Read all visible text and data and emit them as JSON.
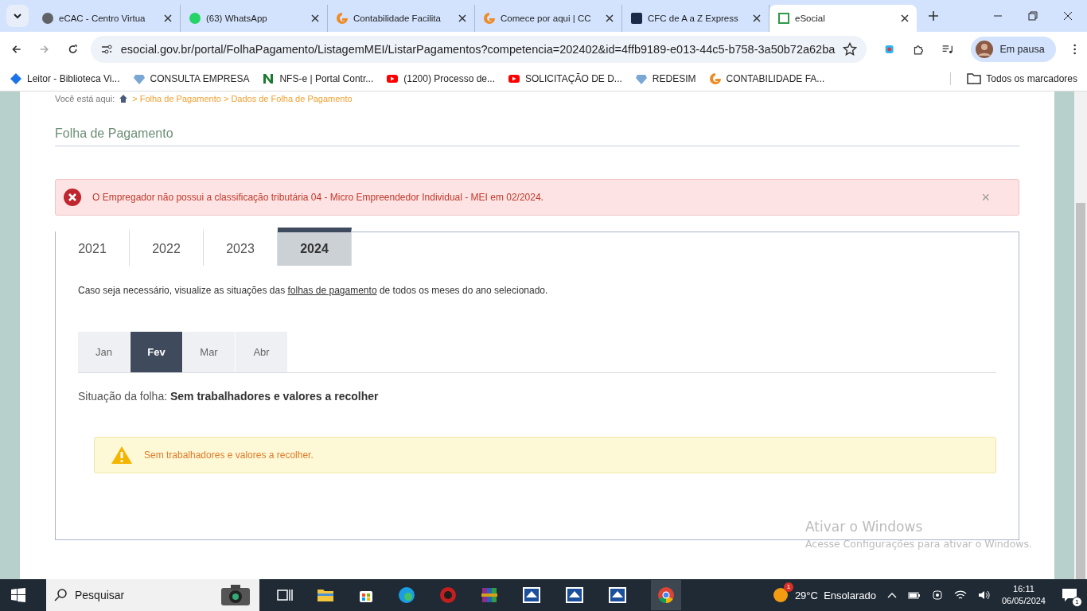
{
  "browser": {
    "tabs": [
      {
        "title": "eCAC - Centro Virtua",
        "selected": false
      },
      {
        "title": "(63) WhatsApp",
        "selected": false
      },
      {
        "title": "Contabilidade Facilita",
        "selected": false
      },
      {
        "title": "Comece por aqui | CC",
        "selected": false
      },
      {
        "title": "CFC de A a Z Express",
        "selected": false
      },
      {
        "title": "eSocial",
        "selected": true
      }
    ],
    "url": "esocial.gov.br/portal/FolhaPagamento/ListagemMEI/ListarPagamentos?competencia=202402&id=4ffb9189-e013-44c5-b758-3a50b72a62ba",
    "profile": "Em pausa",
    "bookmarks": [
      {
        "title": "Leitor - Biblioteca Vi..."
      },
      {
        "title": "CONSULTA EMPRESA"
      },
      {
        "title": "NFS-e | Portal Contr..."
      },
      {
        "title": "(1200) Processo de..."
      },
      {
        "title": "SOLICITAÇÃO DE D..."
      },
      {
        "title": "REDESIM"
      },
      {
        "title": "CONTABILIDADE FA..."
      }
    ],
    "all_bookmarks": "Todos os marcadores"
  },
  "breadcrumb": {
    "label": "Você está aqui:",
    "path": "> Folha de Pagamento > Dados de Folha de Pagamento"
  },
  "page_title": "Folha de Pagamento",
  "error_alert": {
    "message": "O Empregador não possui a classificação tributária 04 - Micro Empreendedor Individual - MEI em 02/2024.",
    "close": "×"
  },
  "years": [
    {
      "label": "2021",
      "selected": false
    },
    {
      "label": "2022",
      "selected": false
    },
    {
      "label": "2023",
      "selected": false
    },
    {
      "label": "2024",
      "selected": true
    }
  ],
  "intro": {
    "before": "Caso seja necessário, visualize as situações das ",
    "link": "folhas de pagamento",
    "after": " de todos os meses do ano selecionado."
  },
  "months": [
    {
      "label": "Jan",
      "selected": false
    },
    {
      "label": "Fev",
      "selected": true
    },
    {
      "label": "Mar",
      "selected": false
    },
    {
      "label": "Abr",
      "selected": false
    }
  ],
  "status": {
    "label": "Situação da folha:",
    "value": "Sem trabalhadores e valores a recolher"
  },
  "warning_alert": {
    "message": "Sem trabalhadores e valores a recolher."
  },
  "activation": {
    "title": "Ativar o Windows",
    "subtitle": "Acesse Configurações para ativar o Windows."
  },
  "taskbar": {
    "search": "Pesquisar",
    "weather": "29°C  Ensolarado",
    "weather_badge": "1",
    "time": "16:11",
    "date": "06/05/2024",
    "notifications": "1"
  }
}
